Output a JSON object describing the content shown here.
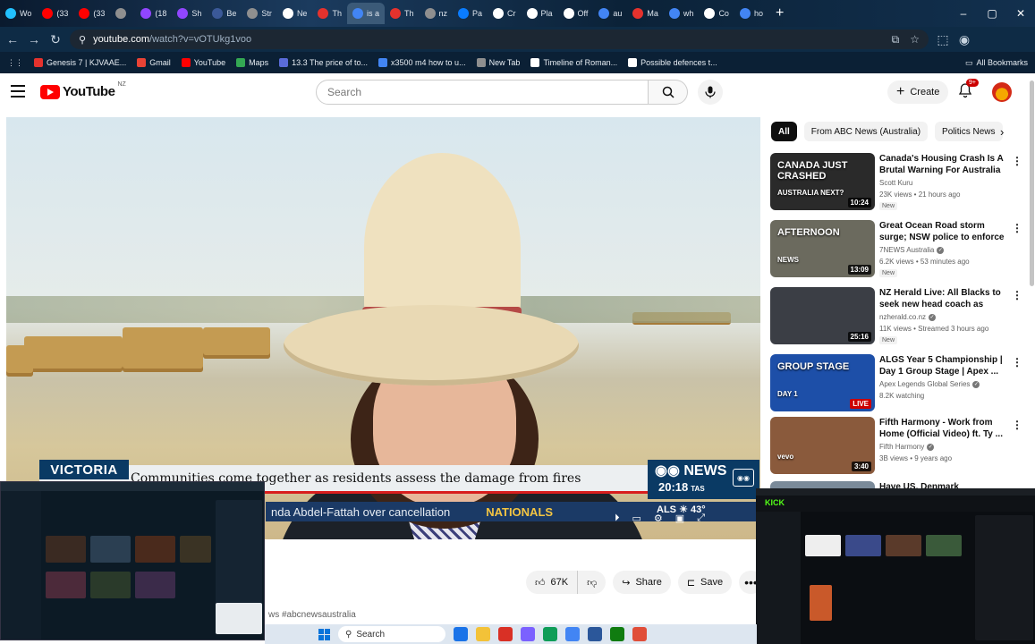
{
  "browser": {
    "tabs": [
      {
        "label": "Wo",
        "color": "#22c1ff"
      },
      {
        "label": "(33",
        "color": "#ff0000"
      },
      {
        "label": "(33",
        "color": "#ff0000"
      },
      {
        "label": "",
        "color": "#8f8f8f"
      },
      {
        "label": "(18",
        "color": "#9146ff"
      },
      {
        "label": "Sh",
        "color": "#9146ff"
      },
      {
        "label": "Be",
        "color": "#3b5998"
      },
      {
        "label": "Str",
        "color": "#8f8f8f"
      },
      {
        "label": "Ne",
        "color": "#ffffff"
      },
      {
        "label": "Th",
        "color": "#e5322d"
      },
      {
        "label": "is a",
        "color": "#4285f4"
      },
      {
        "label": "Th",
        "color": "#e5322d"
      },
      {
        "label": "nz",
        "color": "#8f8f8f"
      },
      {
        "label": "Pa",
        "color": "#0a7cff"
      },
      {
        "label": "Cr",
        "color": "#ffffff"
      },
      {
        "label": "Pla",
        "color": "#ffffff"
      },
      {
        "label": "Off",
        "color": "#ffffff"
      },
      {
        "label": "au",
        "color": "#4285f4"
      },
      {
        "label": "Ma",
        "color": "#e5322d"
      },
      {
        "label": "wh",
        "color": "#4285f4"
      },
      {
        "label": "Co",
        "color": "#ffffff"
      },
      {
        "label": "ho",
        "color": "#4285f4"
      }
    ],
    "new_tab_glyph": "+",
    "window_controls": [
      "–",
      "▢",
      "✕"
    ],
    "url_host": "youtube.com",
    "url_path": "/watch?v=vOTUkg1voo",
    "bookmarks": [
      {
        "label": "Genesis 7 | KJVAAE...",
        "color": "#e5322d"
      },
      {
        "label": "Gmail",
        "color": "#ea4335"
      },
      {
        "label": "YouTube",
        "color": "#ff0000"
      },
      {
        "label": "Maps",
        "color": "#34a853"
      },
      {
        "label": "13.3 The price of to...",
        "color": "#5a6bd8"
      },
      {
        "label": "x3500 m4 how to u...",
        "color": "#4285f4"
      },
      {
        "label": "New Tab",
        "color": "#8f8f8f"
      },
      {
        "label": "Timeline of Roman...",
        "color": "#ffffff"
      },
      {
        "label": "Possible defences t...",
        "color": "#ffffff"
      }
    ],
    "all_bookmarks": "All Bookmarks"
  },
  "youtube": {
    "logo_text": "YouTube",
    "country_code": "NZ",
    "search_placeholder": "Search",
    "create_label": "Create",
    "notification_badge": "9+"
  },
  "video": {
    "state_tag": "VICTORIA",
    "headline": "Communities come together as residents assess the damage from fires",
    "news_brand": "NEWS",
    "news_time": "20:18",
    "news_tz": "TAS",
    "ticker_text": "nda Abdel-Fattah over cancellation",
    "ticker_tail": "NATIONALS",
    "weather_city": "ALS",
    "weather_temp": "43°"
  },
  "actions": {
    "likes": "67K",
    "share": "Share",
    "save": "Save",
    "more": "•••"
  },
  "hashtag_text": "ws #abcnewsaustralia",
  "chips": [
    "All",
    "From ABC News (Australia)",
    "Politics News"
  ],
  "recommendations": [
    {
      "title": "Canada's Housing Crash Is A Brutal Warning For Australia ...",
      "channel": "Scott Kuru",
      "verified": false,
      "meta": "23K views • 21 hours ago",
      "badge": "New",
      "duration": "10:24",
      "live": false,
      "thumb_text": "CANADA JUST CRASHED",
      "thumb_sub": "AUSTRALIA NEXT?",
      "thumb_bg": "#2a2a2a"
    },
    {
      "title": "Great Ocean Road storm surge; NSW police to enforce protest ...",
      "channel": "7NEWS Australia",
      "verified": true,
      "meta": "6.2K views • 53 minutes ago",
      "badge": "New",
      "duration": "13:09",
      "live": false,
      "thumb_text": "AFTERNOON",
      "thumb_sub": "NEWS",
      "thumb_bg": "#6b6a5e"
    },
    {
      "title": "NZ Herald Live: All Blacks to seek new head coach as Scott...",
      "channel": "nzherald.co.nz",
      "verified": true,
      "meta": "11K views • Streamed 3 hours ago",
      "badge": "New",
      "duration": "25:16",
      "live": false,
      "thumb_text": "",
      "thumb_sub": "",
      "thumb_bg": "#3b3e45"
    },
    {
      "title": "ALGS Year 5 Championship | Day 1 Group Stage | Apex ...",
      "channel": "Apex Legends Global Series",
      "verified": true,
      "meta": "8.2K watching",
      "badge": "",
      "duration": "LIVE",
      "live": true,
      "thumb_text": "GROUP STAGE",
      "thumb_sub": "DAY 1",
      "thumb_bg": "#1d4fa8"
    },
    {
      "title": "Fifth Harmony - Work from Home (Official Video) ft. Ty ...",
      "channel": "Fifth Harmony",
      "verified": true,
      "meta": "3B views • 9 years ago",
      "badge": "",
      "duration": "3:40",
      "live": false,
      "thumb_text": "",
      "thumb_sub": "vevo",
      "thumb_bg": "#8a5a3c"
    },
    {
      "title": "Have US, Denmark Greenland",
      "channel": "",
      "verified": false,
      "meta": "",
      "badge": "",
      "duration": "",
      "live": false,
      "thumb_text": "",
      "thumb_sub": "",
      "thumb_bg": "#7a8a99"
    }
  ],
  "taskbar": {
    "search_label": "Search",
    "icons": [
      "#1a73e8",
      "#f3c238",
      "#d93025",
      "#7b61ff",
      "#0f9d58",
      "#4285f4",
      "#2b579a",
      "#107c10",
      "#e04e39"
    ]
  }
}
